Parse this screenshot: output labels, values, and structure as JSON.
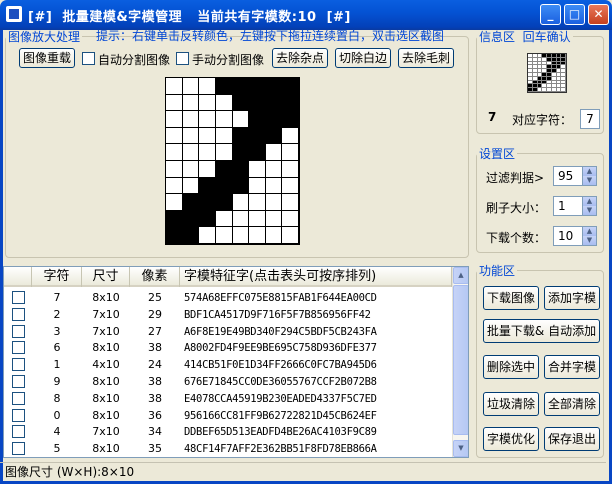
{
  "window": {
    "title": "[#]  批量建模&字模管理   当前共有字模数:10  [#]",
    "min_label": "_",
    "max_label": "□",
    "close_label": "✕"
  },
  "image_panel": {
    "legend": "图像放大处理",
    "hint": "提示：右键单击反转颜色，左键按下拖拉连续置白，双击选区截图",
    "reset_button": "图像重载",
    "auto_split_label": "自动分割图像",
    "manual_split_label": "手动分割图像",
    "remove_noise_button": "去除杂点",
    "cut_border_button": "切除白边",
    "remove_burr_button": "去除毛刺",
    "pixels": [
      "00011111",
      "00001111",
      "00000111",
      "00001110",
      "00001100",
      "00011000",
      "00111000",
      "01110000",
      "11100000",
      "11000000"
    ]
  },
  "info_panel": {
    "legend": "信息区",
    "confirm_label": "回车确认",
    "char_symbol": "7",
    "char_label": "对应字符：",
    "char_value": "7"
  },
  "settings_panel": {
    "legend": "设置区",
    "filter_label": "过滤判据>",
    "filter_value": "95",
    "brush_label": "刷子大小：",
    "brush_value": "1",
    "download_label": "下载个数：",
    "download_value": "10",
    "up_arrow": "▲",
    "down_arrow": "▼"
  },
  "function_panel": {
    "legend": "功能区",
    "download_image": "下载图像",
    "add_template": "添加字模",
    "batch_download": "批量下载& 自动添加",
    "delete_selected": "删除选中",
    "merge_template": "合并字模",
    "clean_garbage": "垃圾清除",
    "clear_all": "全部清除",
    "optimize": "字模优化",
    "save_exit": "保存退出"
  },
  "table": {
    "headers": [
      "",
      "字符",
      "尺寸",
      "像素",
      "字模特征字(点击表头可按序排列)"
    ],
    "rows": [
      {
        "char": "7",
        "size": "8x10",
        "pixels": "25",
        "hex": "574A68EFFC075E8815FAB1F644EA00CD"
      },
      {
        "char": "2",
        "size": "7x10",
        "pixels": "29",
        "hex": "BDF1CA4517D9F716F5F7B856956FF42"
      },
      {
        "char": "3",
        "size": "7x10",
        "pixels": "27",
        "hex": "A6F8E19E49BD340F294C5BDF5CB243FA"
      },
      {
        "char": "6",
        "size": "8x10",
        "pixels": "38",
        "hex": "A8002FD4F9EE9BE695C758D936DFE377"
      },
      {
        "char": "1",
        "size": "4x10",
        "pixels": "24",
        "hex": "414CB51F0E1D34FF2666C0FC7BA945D6"
      },
      {
        "char": "9",
        "size": "8x10",
        "pixels": "38",
        "hex": "676E71845CC0DE36055767CCF2B072B8"
      },
      {
        "char": "8",
        "size": "8x10",
        "pixels": "38",
        "hex": "E4078CCA45919B230EADED4337F5C7ED"
      },
      {
        "char": "0",
        "size": "8x10",
        "pixels": "36",
        "hex": "956166CC81FF9B62722821D45CB624EF"
      },
      {
        "char": "4",
        "size": "7x10",
        "pixels": "34",
        "hex": "DDBEF65D513EADFD4BE26AC4103F9C89"
      },
      {
        "char": "5",
        "size": "8x10",
        "pixels": "35",
        "hex": "48CF14F7AFF2E362BB51F8FD78EB866A"
      }
    ]
  },
  "status_bar": {
    "text": "图像尺寸 (W×H):8×10"
  }
}
